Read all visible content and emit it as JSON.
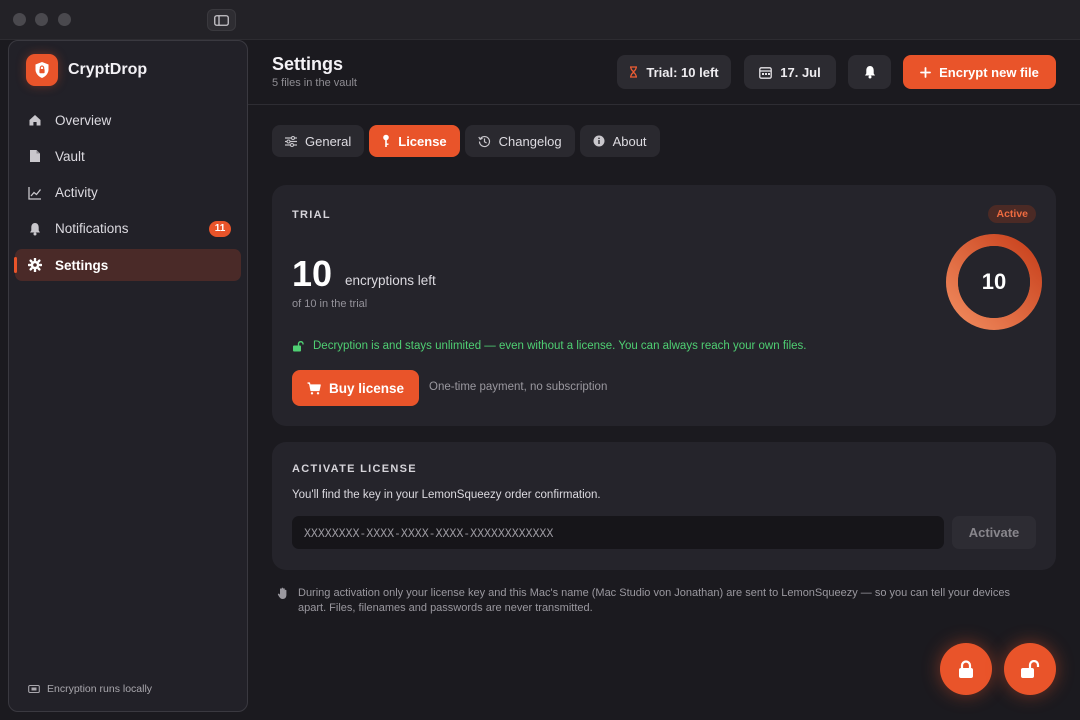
{
  "app": {
    "name": "CryptDrop"
  },
  "sidebar": {
    "items": [
      {
        "label": "Overview",
        "icon": "home-icon"
      },
      {
        "label": "Vault",
        "icon": "file-icon"
      },
      {
        "label": "Activity",
        "icon": "chart-icon"
      },
      {
        "label": "Notifications",
        "icon": "bell-icon",
        "badge": "11"
      },
      {
        "label": "Settings",
        "icon": "gear-icon",
        "active": true
      }
    ],
    "footer": "Encryption runs locally"
  },
  "header": {
    "title": "Settings",
    "subtitle": "5 files in the vault",
    "trial_label": "Trial: 10 left",
    "date_label": "17. Jul",
    "primary_label": "Encrypt new file"
  },
  "tabs": [
    {
      "label": "General",
      "icon": "sliders-icon"
    },
    {
      "label": "License",
      "icon": "key-icon",
      "active": true
    },
    {
      "label": "Changelog",
      "icon": "history-icon"
    },
    {
      "label": "About",
      "icon": "info-icon"
    }
  ],
  "trial_card": {
    "label": "TRIAL",
    "status": "Active",
    "count": "10",
    "unit": "encryptions left",
    "note": "of 10 in the trial",
    "ring_value": "10",
    "ring_fraction": 1.0,
    "decrypt_note": "Decryption is and stays unlimited — even without a license. You can always reach your own files.",
    "buy_label": "Buy license",
    "buy_note": "One-time payment, no subscription"
  },
  "activate_card": {
    "label": "ACTIVATE LICENSE",
    "desc": "You'll find the key in your LemonSqueezy order confirmation.",
    "placeholder": "XXXXXXXX-XXXX-XXXX-XXXX-XXXXXXXXXXXX",
    "button": "Activate"
  },
  "privacy_note": "During activation only your license key and this Mac's name (Mac Studio von Jonathan) are sent to LemonSqueezy — so you can tell your devices apart. Files, filenames and passwords are never transmitted.",
  "colors": {
    "accent": "#e9542a",
    "success": "#4fcf73",
    "background": "#1b1a1f",
    "card": "#25242b"
  }
}
